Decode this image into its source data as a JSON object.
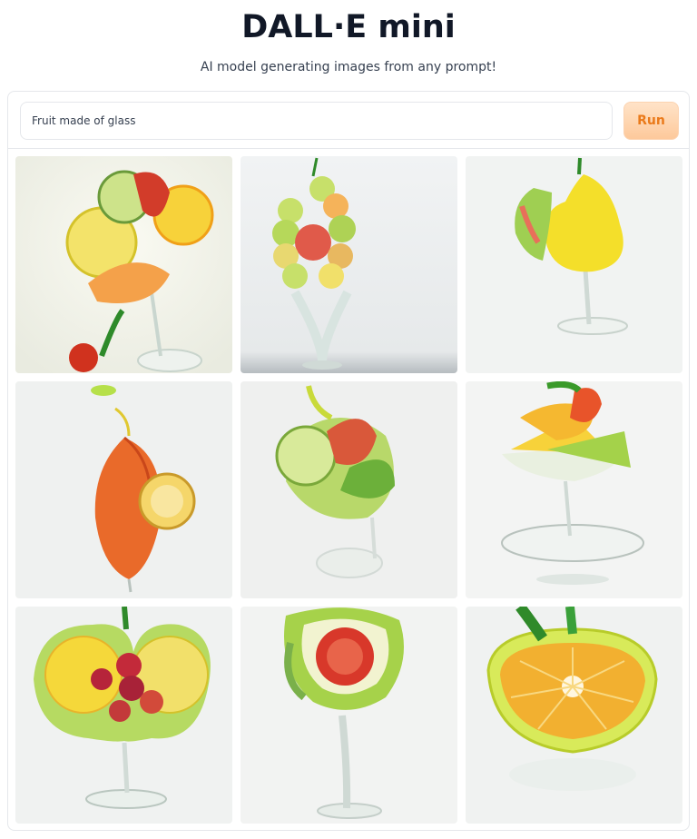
{
  "header": {
    "title": "DALL·E mini",
    "subtitle": "AI model generating images from any prompt!"
  },
  "prompt": {
    "value": "Fruit made of glass",
    "run_label": "Run"
  },
  "gallery": {
    "images": [
      {
        "name": "generated-image-1",
        "subject": "citrus slices glass"
      },
      {
        "name": "generated-image-2",
        "subject": "strawberry cluster goblet"
      },
      {
        "name": "generated-image-3",
        "subject": "yellow pear glass"
      },
      {
        "name": "generated-image-4",
        "subject": "papaya with lemon slice"
      },
      {
        "name": "generated-image-5",
        "subject": "lime and watermelon swirl"
      },
      {
        "name": "generated-image-6",
        "subject": "mango slices martini glass"
      },
      {
        "name": "generated-image-7",
        "subject": "lemon with raspberries"
      },
      {
        "name": "generated-image-8",
        "subject": "avocado wine glass"
      },
      {
        "name": "generated-image-9",
        "subject": "orange half bowl"
      }
    ]
  }
}
